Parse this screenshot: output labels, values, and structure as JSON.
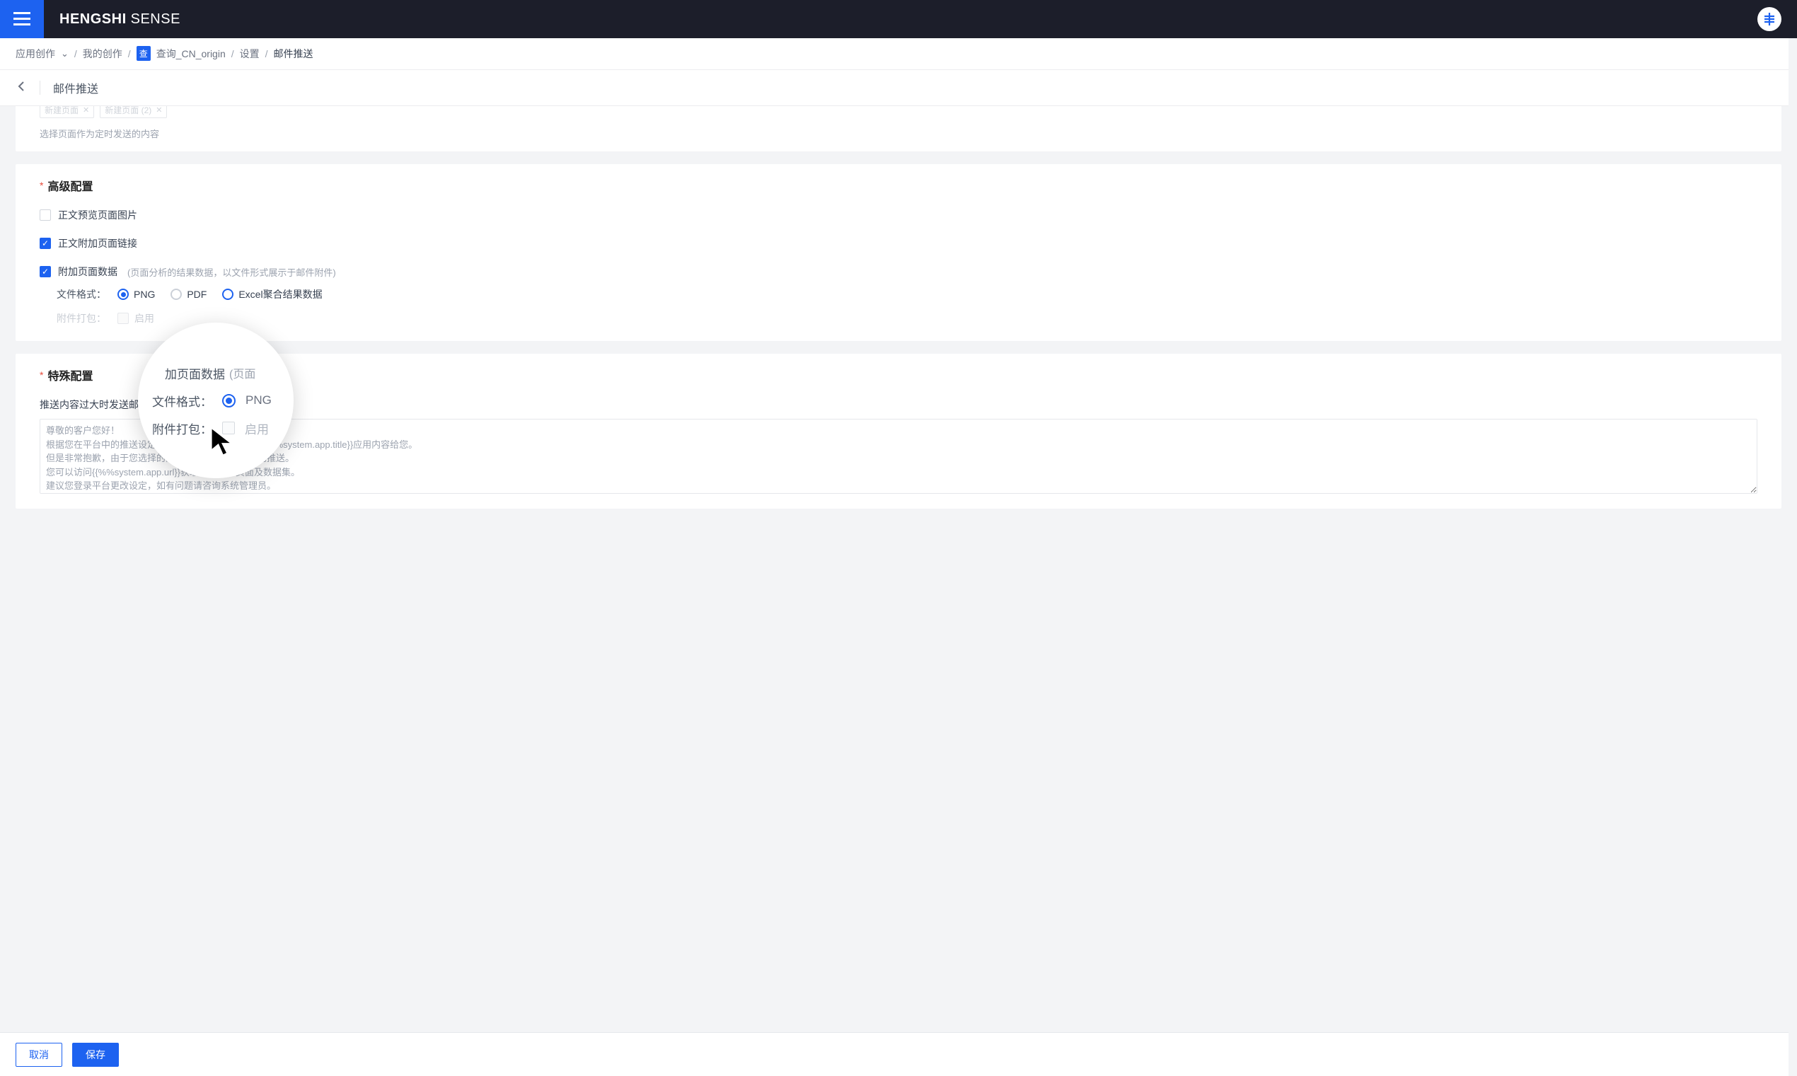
{
  "brand": {
    "bold": "HENGSHI",
    "light": "SENSE"
  },
  "breadcrumb": {
    "app": "应用创作",
    "mine": "我的创作",
    "chip": "查",
    "doc": "查询_CN_origin",
    "settings": "设置",
    "current": "邮件推送"
  },
  "page": {
    "title": "邮件推送"
  },
  "top_card": {
    "tag1": "新建页面",
    "tag2": "新建页面 (2)",
    "helper": "选择页面作为定时发送的内容"
  },
  "advanced": {
    "title": "高级配置",
    "preview_image": "正文预览页面图片",
    "attach_link": "正文附加页面链接",
    "attach_data": "附加页面数据",
    "attach_data_hint": "(页面分析的结果数据，以文件形式展示于邮件附件)",
    "file_format_label": "文件格式：",
    "fmt_png": "PNG",
    "fmt_pdf": "PDF",
    "fmt_excel": "Excel聚合结果数据",
    "pack_label": "附件打包：",
    "pack_enable": "启用"
  },
  "special": {
    "title": "特殊配置",
    "oversize_label": "推送内容过大时发送邮件",
    "textarea_value": "尊敬的客户您好！\n根据您在平台中的推送设定，                              推送{{%%system.app.title}}应用内容给您。\n但是非常抱歉，由于您选择的内容过大，系统无法自动推送。\n您可以访问{{%%system.app.url}}获取应用所有页面及数据集。\n建议您登录平台更改设定，如有问题请咨询系统管理员。"
  },
  "magnifier": {
    "top_title_snip": "加页面数据",
    "top_hint_snip": "(页面",
    "format_label": "文件格式：",
    "fmt_png": "PNG",
    "pack_label": "附件打包：",
    "pack_enable": "启用"
  },
  "footer": {
    "cancel": "取消",
    "save": "保存"
  }
}
